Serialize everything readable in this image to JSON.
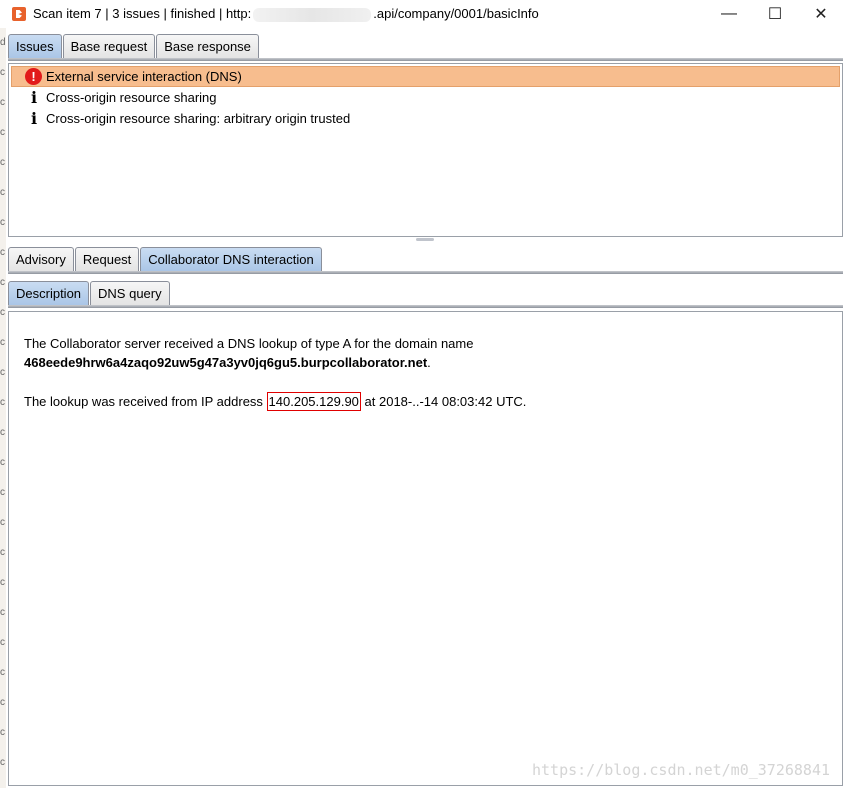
{
  "window": {
    "title_prefix": "Scan item 7 | 3 issues | finished | http:",
    "title_suffix": ".api/company/0001/basicInfo",
    "minimize": "—",
    "maximize": "☐",
    "close": "✕"
  },
  "top_tabs": [
    "Issues",
    "Base request",
    "Base response"
  ],
  "issues": [
    {
      "label": "External service interaction (DNS)",
      "icon": "error-icon",
      "selected": true
    },
    {
      "label": "Cross-origin resource sharing",
      "icon": "info-icon",
      "selected": false
    },
    {
      "label": "Cross-origin resource sharing: arbitrary origin trusted",
      "icon": "info-icon",
      "selected": false
    }
  ],
  "detail_tabs": [
    "Advisory",
    "Request",
    "Collaborator DNS interaction"
  ],
  "sub_tabs": [
    "Description",
    "DNS query"
  ],
  "description": {
    "line1": "The Collaborator server received a DNS lookup of type A for the domain name",
    "domain": "468eede9hrw6a4zaqo92uw5g47a3yv0jq6gu5.burpcollaborator.net",
    "domain_suffix": ".",
    "line3_prefix": "The lookup was received from IP address ",
    "ip": "140.205.129.90",
    "line3_suffix": " at 2018-..-14 08:03:42 UTC."
  },
  "watermark": "https://blog.csdn.net/m0_37268841",
  "colors": {
    "selected_row": "#f7bd8e",
    "active_tab": "#b5cfec",
    "error_icon": "#e21a1a",
    "ip_highlight_border": "#e00000"
  }
}
